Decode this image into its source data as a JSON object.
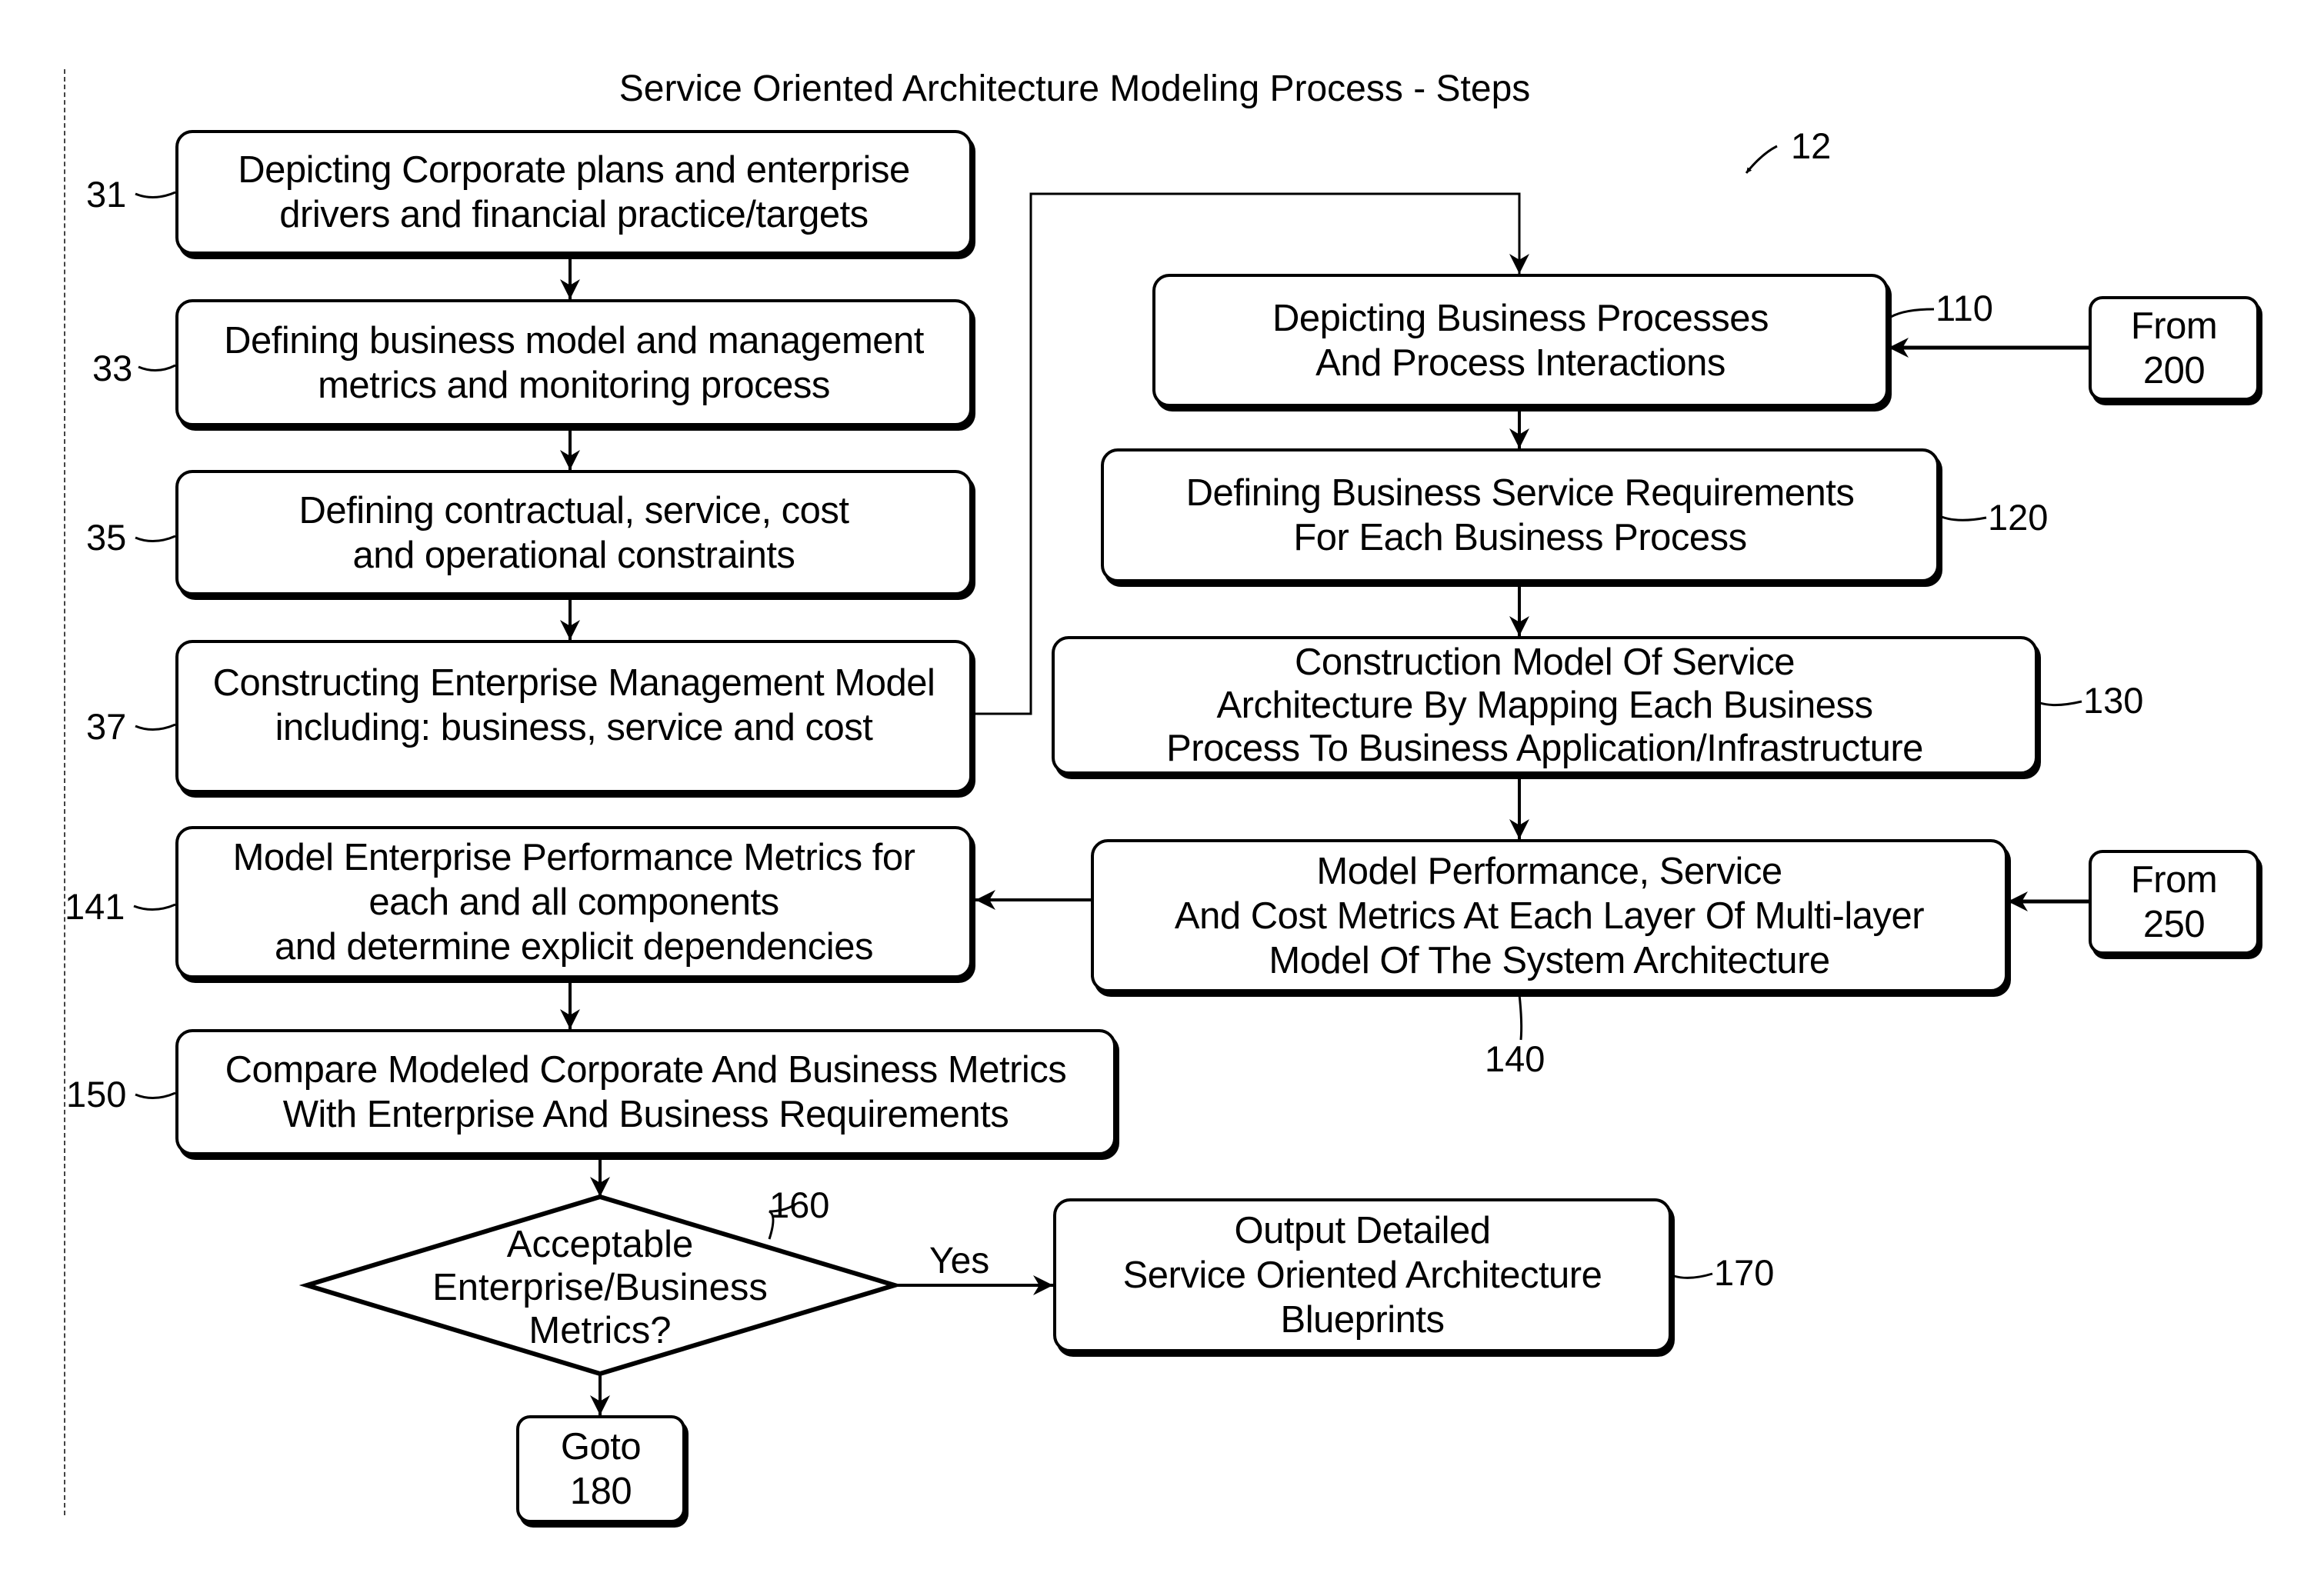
{
  "diagram": {
    "title": "Service Oriented Architecture Modeling Process - Steps",
    "figure_ref": "12",
    "steps": [
      {
        "id": "31",
        "lines": [
          "Depicting Corporate plans and enterprise",
          "drivers and financial practice/targets"
        ]
      },
      {
        "id": "33",
        "lines": [
          "Defining business model and management",
          "metrics and monitoring process"
        ]
      },
      {
        "id": "35",
        "lines": [
          "Defining contractual, service, cost",
          "and operational constraints"
        ]
      },
      {
        "id": "37",
        "lines": [
          "Constructing Enterprise Management Model",
          "including: business, service and cost"
        ]
      },
      {
        "id": "110",
        "lines": [
          "Depicting Business Processes",
          "And Process Interactions"
        ]
      },
      {
        "id": "120",
        "lines": [
          "Defining Business Service Requirements",
          "For Each Business Process"
        ]
      },
      {
        "id": "130",
        "lines": [
          "Construction Model Of Service",
          "Architecture By Mapping Each Business",
          "Process To Business Application/Infrastructure"
        ]
      },
      {
        "id": "140",
        "lines": [
          "Model Performance, Service",
          "And Cost Metrics At Each Layer Of Multi-layer",
          "Model Of The System Architecture"
        ]
      },
      {
        "id": "141",
        "lines": [
          "Model Enterprise Performance Metrics for",
          "each and all components",
          "and determine explicit dependencies"
        ]
      },
      {
        "id": "150",
        "lines": [
          "Compare Modeled Corporate And Business Metrics",
          "With Enterprise And Business Requirements"
        ]
      },
      {
        "id": "170",
        "lines": [
          "Output Detailed",
          "Service Oriented Architecture",
          "Blueprints"
        ]
      }
    ],
    "decision": {
      "id": "160",
      "lines": [
        "Acceptable",
        "Enterprise/Business",
        "Metrics?"
      ],
      "yes_label": "Yes"
    },
    "connectors": [
      {
        "id": "from200",
        "lines": [
          "From",
          "200"
        ]
      },
      {
        "id": "from250",
        "lines": [
          "From",
          "250"
        ]
      },
      {
        "id": "goto180",
        "lines": [
          "Goto",
          "180"
        ]
      }
    ]
  }
}
